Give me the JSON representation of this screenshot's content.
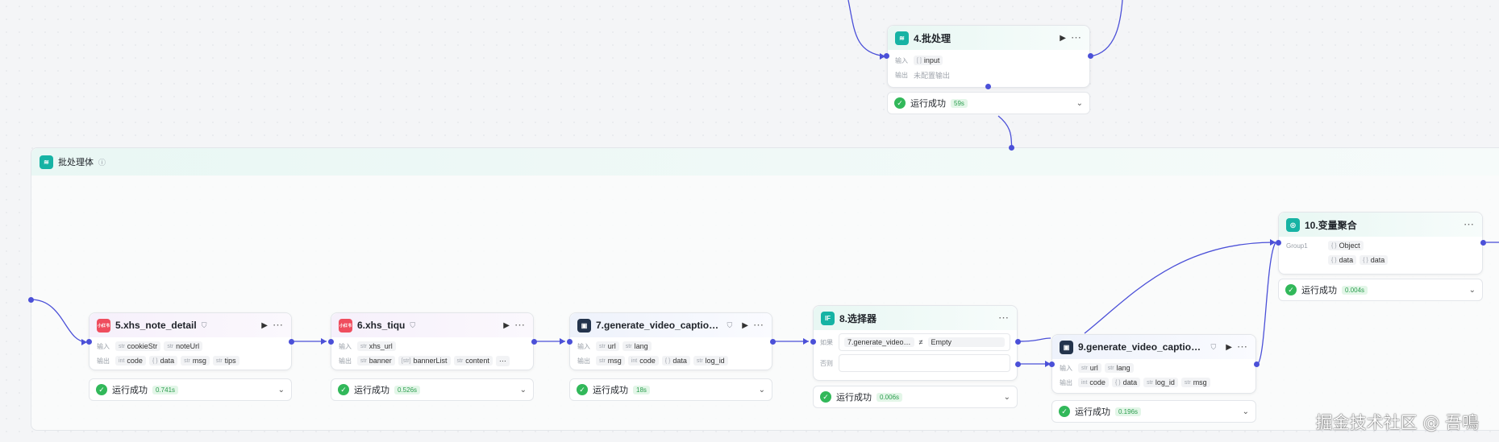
{
  "batch_node": {
    "title": "4.批处理",
    "input_label": "输入",
    "input_type": "[ ]",
    "input_value": "input",
    "output_label": "输出",
    "output_value": "未配置输出",
    "status": "运行成功",
    "time": "59s"
  },
  "container": {
    "title": "批处理体"
  },
  "nodes": [
    {
      "title": "5.xhs_note_detail",
      "in_label": "输入",
      "inputs": [
        {
          "t": "str",
          "v": "cookieStr"
        },
        {
          "t": "str",
          "v": "noteUrl"
        }
      ],
      "out_label": "输出",
      "outputs": [
        {
          "t": "int",
          "v": "code"
        },
        {
          "t": "{ }",
          "v": "data"
        },
        {
          "t": "str",
          "v": "msg"
        },
        {
          "t": "str",
          "v": "tips"
        }
      ],
      "status": "运行成功",
      "time": "0.741s"
    },
    {
      "title": "6.xhs_tiqu",
      "in_label": "输入",
      "inputs": [
        {
          "t": "str",
          "v": "xhs_url"
        }
      ],
      "out_label": "输出",
      "outputs": [
        {
          "t": "str",
          "v": "banner"
        },
        {
          "t": "[str]",
          "v": "bannerList"
        },
        {
          "t": "str",
          "v": "content"
        }
      ],
      "status": "运行成功",
      "time": "0.526s"
    },
    {
      "title": "7.generate_video_captions…",
      "in_label": "输入",
      "inputs": [
        {
          "t": "str",
          "v": "url"
        },
        {
          "t": "str",
          "v": "lang"
        }
      ],
      "out_label": "输出",
      "outputs": [
        {
          "t": "str",
          "v": "msg"
        },
        {
          "t": "int",
          "v": "code"
        },
        {
          "t": "{ }",
          "v": "data"
        },
        {
          "t": "str",
          "v": "log_id"
        }
      ],
      "status": "运行成功",
      "time": "18s"
    },
    {
      "title": "9.generate_video_captions…",
      "in_label": "输入",
      "inputs": [
        {
          "t": "str",
          "v": "url"
        },
        {
          "t": "str",
          "v": "lang"
        }
      ],
      "out_label": "输出",
      "outputs": [
        {
          "t": "int",
          "v": "code"
        },
        {
          "t": "{ }",
          "v": "data"
        },
        {
          "t": "str",
          "v": "log_id"
        },
        {
          "t": "str",
          "v": "msg"
        }
      ],
      "status": "运行成功",
      "time": "0.196s"
    }
  ],
  "selector": {
    "title": "8.选择器",
    "if_label": "如果",
    "condition_left": "7.generate_video…",
    "operator": "≠",
    "condition_right": "Empty",
    "else_label": "否则",
    "status": "运行成功",
    "time": "0.006s"
  },
  "aggregate": {
    "title": "10.变量聚合",
    "group_label": "Group1",
    "group_value_t": "{ }",
    "group_value": "Object",
    "outputs": [
      {
        "t": "{ }",
        "v": "data"
      },
      {
        "t": "{ }",
        "v": "data"
      }
    ],
    "status": "运行成功",
    "time": "0.004s"
  },
  "icons": {
    "xhs_badge": "小红书",
    "if_badge": "IF"
  },
  "watermark": "掘金技术社区 @ 吾鳴",
  "colors": {
    "wire": "#4b50d8",
    "success": "#32b85a",
    "teal": "#16b3a4"
  }
}
